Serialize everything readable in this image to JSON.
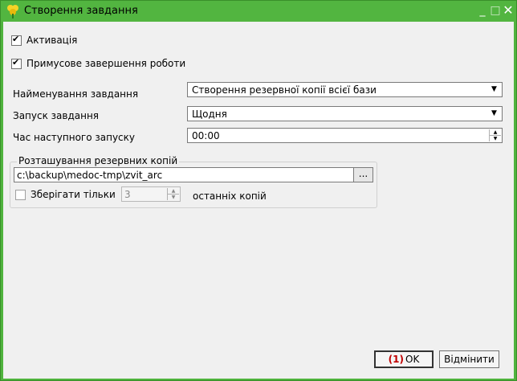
{
  "window": {
    "title": "Створення завдання",
    "icon": "flower-app-icon",
    "controls": {
      "minimize": "_",
      "maximize": "□",
      "close": "✕"
    }
  },
  "options": {
    "activation": {
      "label": "Активація",
      "checked": true
    },
    "force_shutdown": {
      "label": "Примусове завершення роботи",
      "checked": true
    }
  },
  "fields": {
    "task_name": {
      "label": "Найменування завдання",
      "value": "Створення резервної копії всієї бази"
    },
    "task_start": {
      "label": "Запуск завдання",
      "value": "Щодня"
    },
    "next_run": {
      "label": "Час наступного запуску",
      "value": "00:00"
    }
  },
  "backup_location": {
    "group_label": "Розташування резервних копій",
    "path": "c:\\backup\\medoc-tmp\\zvit_arc",
    "browse_label": "...",
    "keep_only": {
      "label": "Зберігати тільки",
      "checked": false,
      "value": "3",
      "suffix": "останніх копій"
    }
  },
  "buttons": {
    "ok": {
      "badge": "(1)",
      "label": "OK"
    },
    "cancel": {
      "label": "Відмінити"
    }
  },
  "colors": {
    "titlebar": "#52b540",
    "background": "#f0f0f0",
    "badge": "#c00000"
  }
}
